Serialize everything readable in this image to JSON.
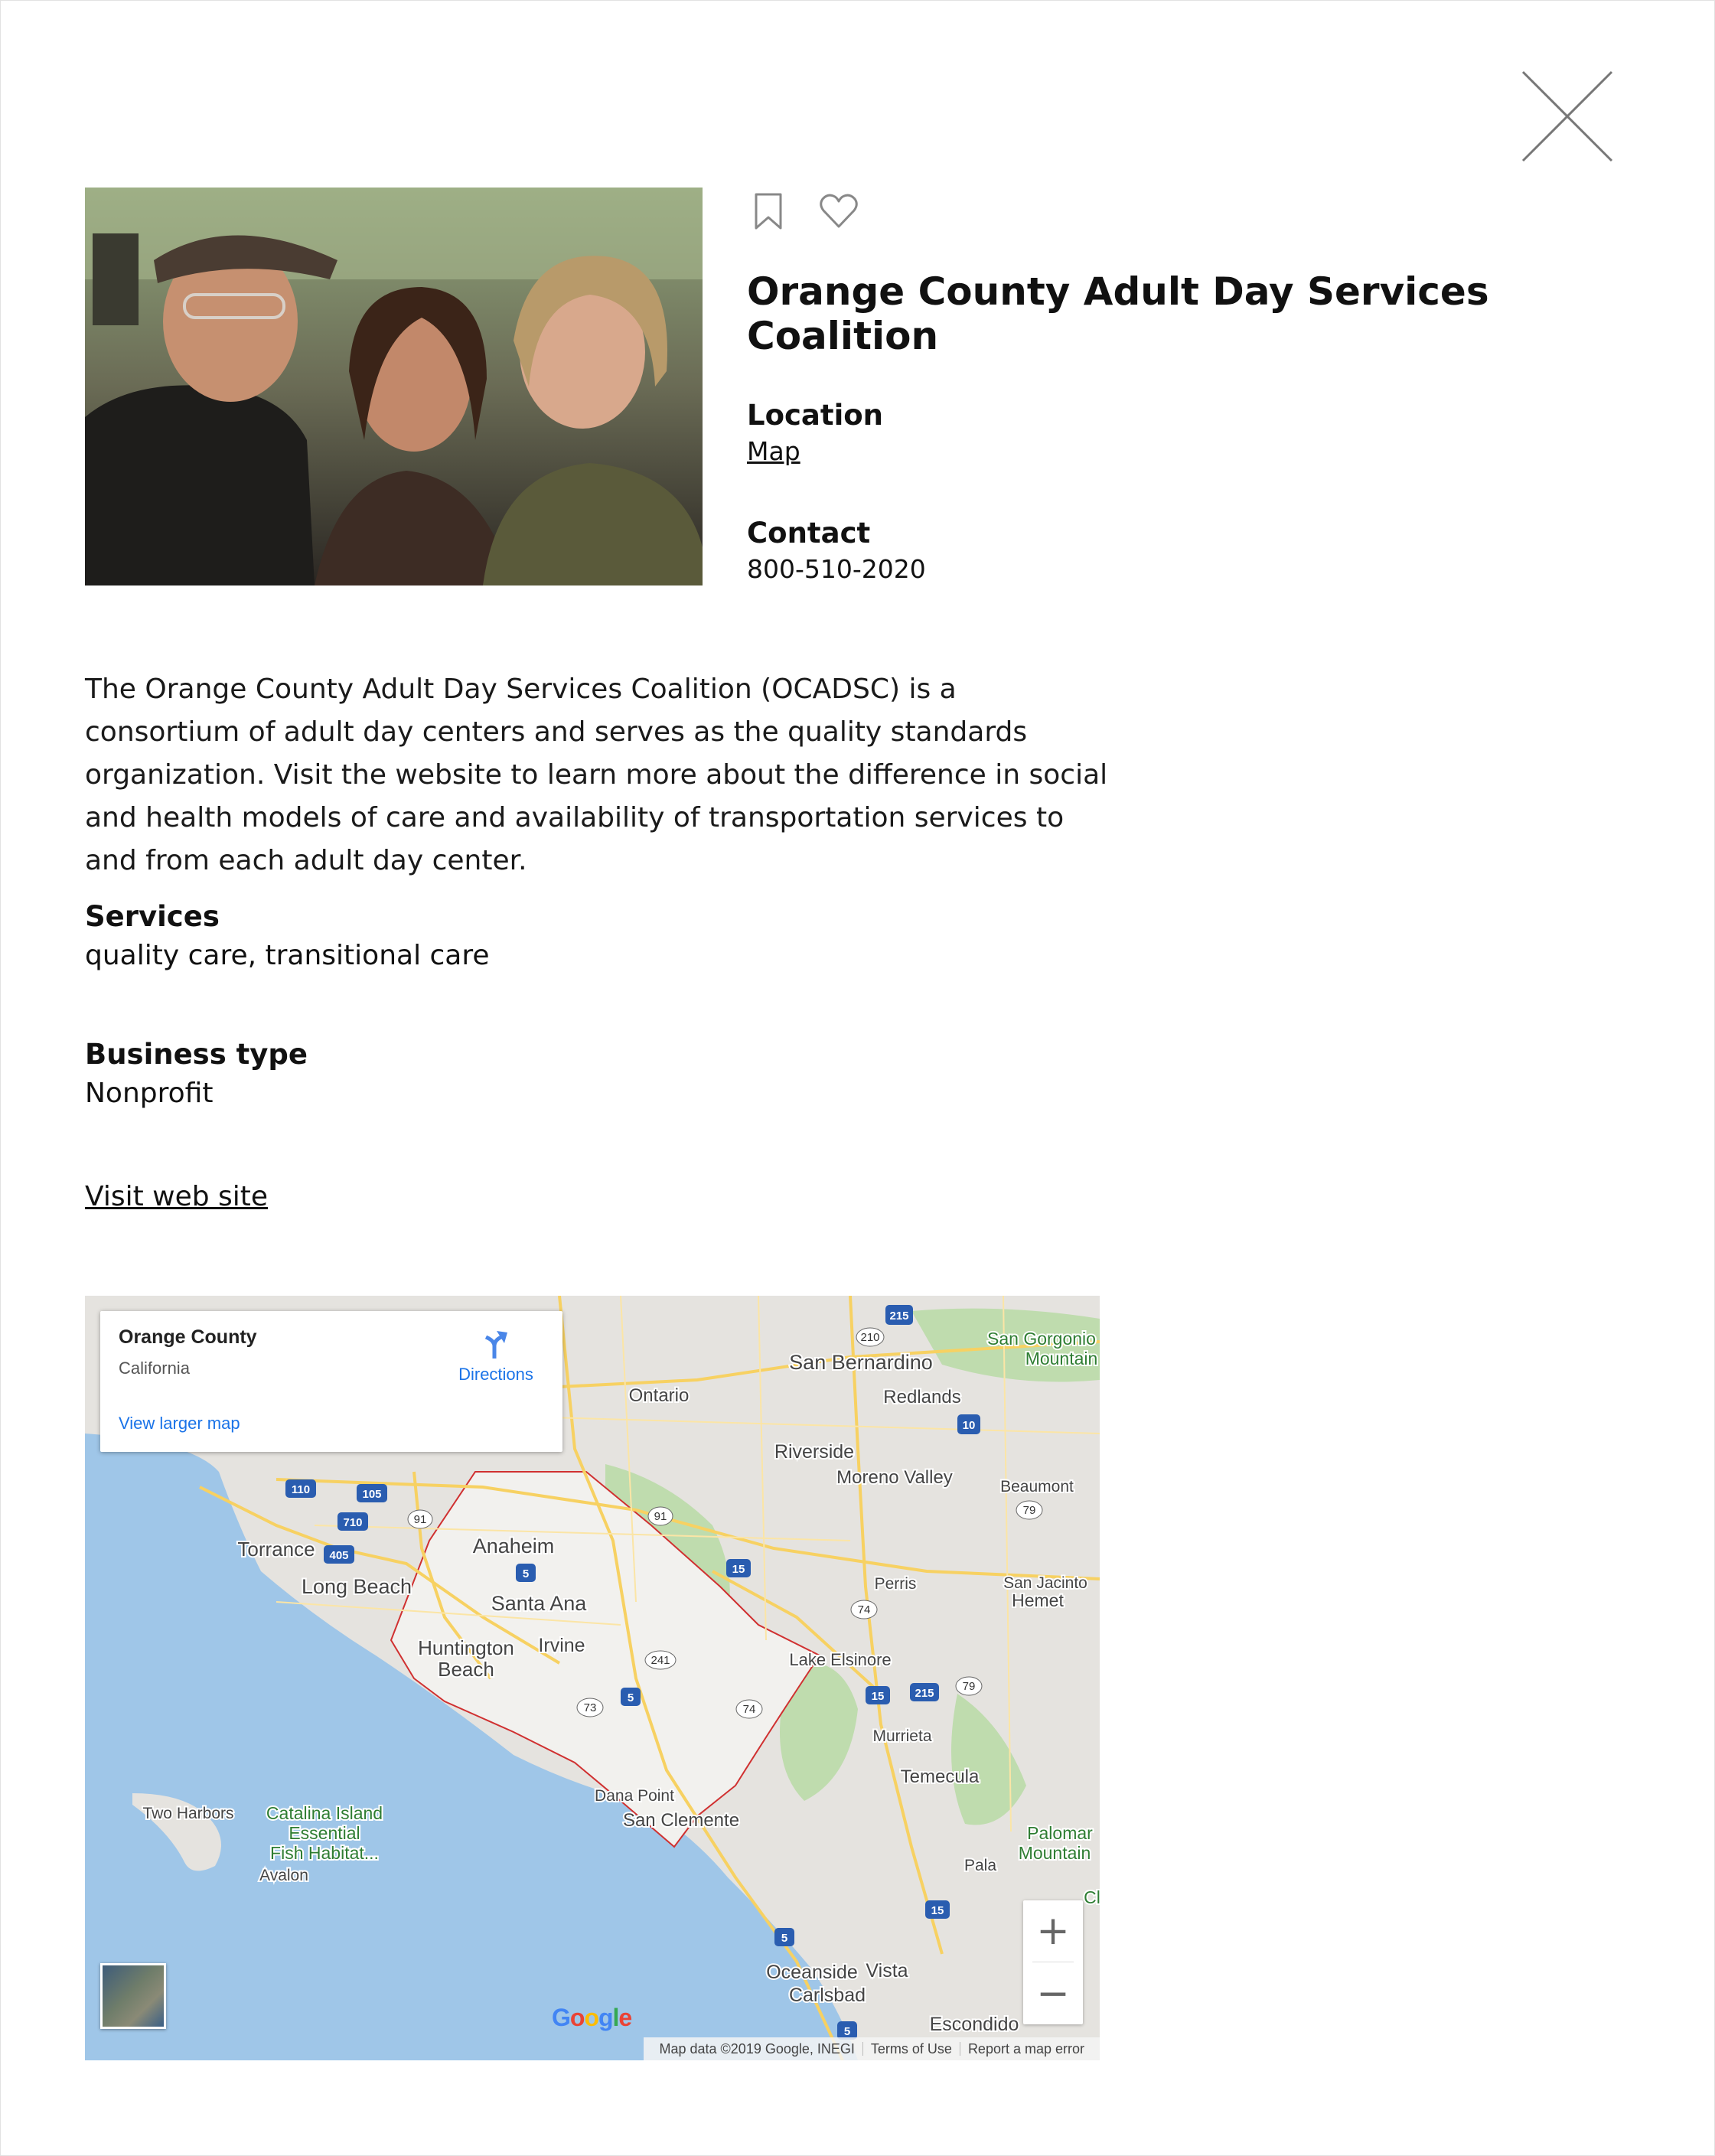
{
  "org": {
    "title": "Orange County Adult Day Services Coalition",
    "location_label": "Location",
    "location_link": "Map",
    "contact_label": "Contact",
    "phone": "800-510-2020",
    "description": "The Orange County Adult Day Services Coalition (OCADSC) is a consortium of adult day centers and serves as the quality standards organization. Visit the website to learn more about the difference in social and health models of care and availability of transportation services to and from each adult day center.",
    "services_label": "Services",
    "services": "quality care, transitional care",
    "business_label": "Business type",
    "business_type": "Nonprofit",
    "website_link": "Visit web site"
  },
  "icons": {
    "close": "close-icon",
    "bookmark": "bookmark-icon",
    "favorite": "heart-icon"
  },
  "map": {
    "info_title": "Orange County",
    "info_subtitle": "California",
    "directions": "Directions",
    "larger_map": "View larger map",
    "zoom_in": "+",
    "zoom_out": "−",
    "google": "Google",
    "map_data": "Map data ©2019 Google, INEGI",
    "terms": "Terms of Use",
    "report": "Report a map error",
    "places": {
      "ontario": "Ontario",
      "san_bernardino": "San Bernardino",
      "redlands": "Redlands",
      "san_gorgonio": "San Gorgonio",
      "mountain": "Mountain",
      "riverside": "Riverside",
      "moreno_valley": "Moreno Valley",
      "beaumont": "Beaumont",
      "torrance": "Torrance",
      "anaheim": "Anaheim",
      "long_beach": "Long Beach",
      "santa_ana": "Santa Ana",
      "perris": "Perris",
      "san_jacinto": "San Jacinto",
      "hemet": "Hemet",
      "huntington": "Huntington",
      "beach": "Beach",
      "irvine": "Irvine",
      "lake_elsinore": "Lake Elsinore",
      "murrieta": "Murrieta",
      "temecula": "Temecula",
      "dana_point": "Dana Point",
      "san_clemente": "San Clemente",
      "two_harbors": "Two Harbors",
      "catalina_1": "Catalina Island",
      "catalina_2": "Essential",
      "catalina_3": "Fish Habitat...",
      "avalon": "Avalon",
      "palomar": "Palomar",
      "palomar_mtn": "Mountain",
      "pala": "Pala",
      "oceanside": "Oceanside",
      "vista": "Vista",
      "carlsbad": "Carlsbad",
      "escondido": "Escondido",
      "clipped": "Cl"
    },
    "shields": {
      "i215a": "215",
      "s210": "210",
      "i10": "10",
      "i110": "110",
      "i105": "105",
      "i710": "710",
      "s91a": "91",
      "s91b": "91",
      "i405": "405",
      "i5a": "5",
      "i15a": "15",
      "s79a": "79",
      "s74a": "74",
      "s241": "241",
      "i15b": "15",
      "i215b": "215",
      "s79b": "79",
      "s73": "73",
      "i5b": "5",
      "s74b": "74",
      "i15c": "15",
      "i5c": "5",
      "i5d": "5"
    }
  }
}
